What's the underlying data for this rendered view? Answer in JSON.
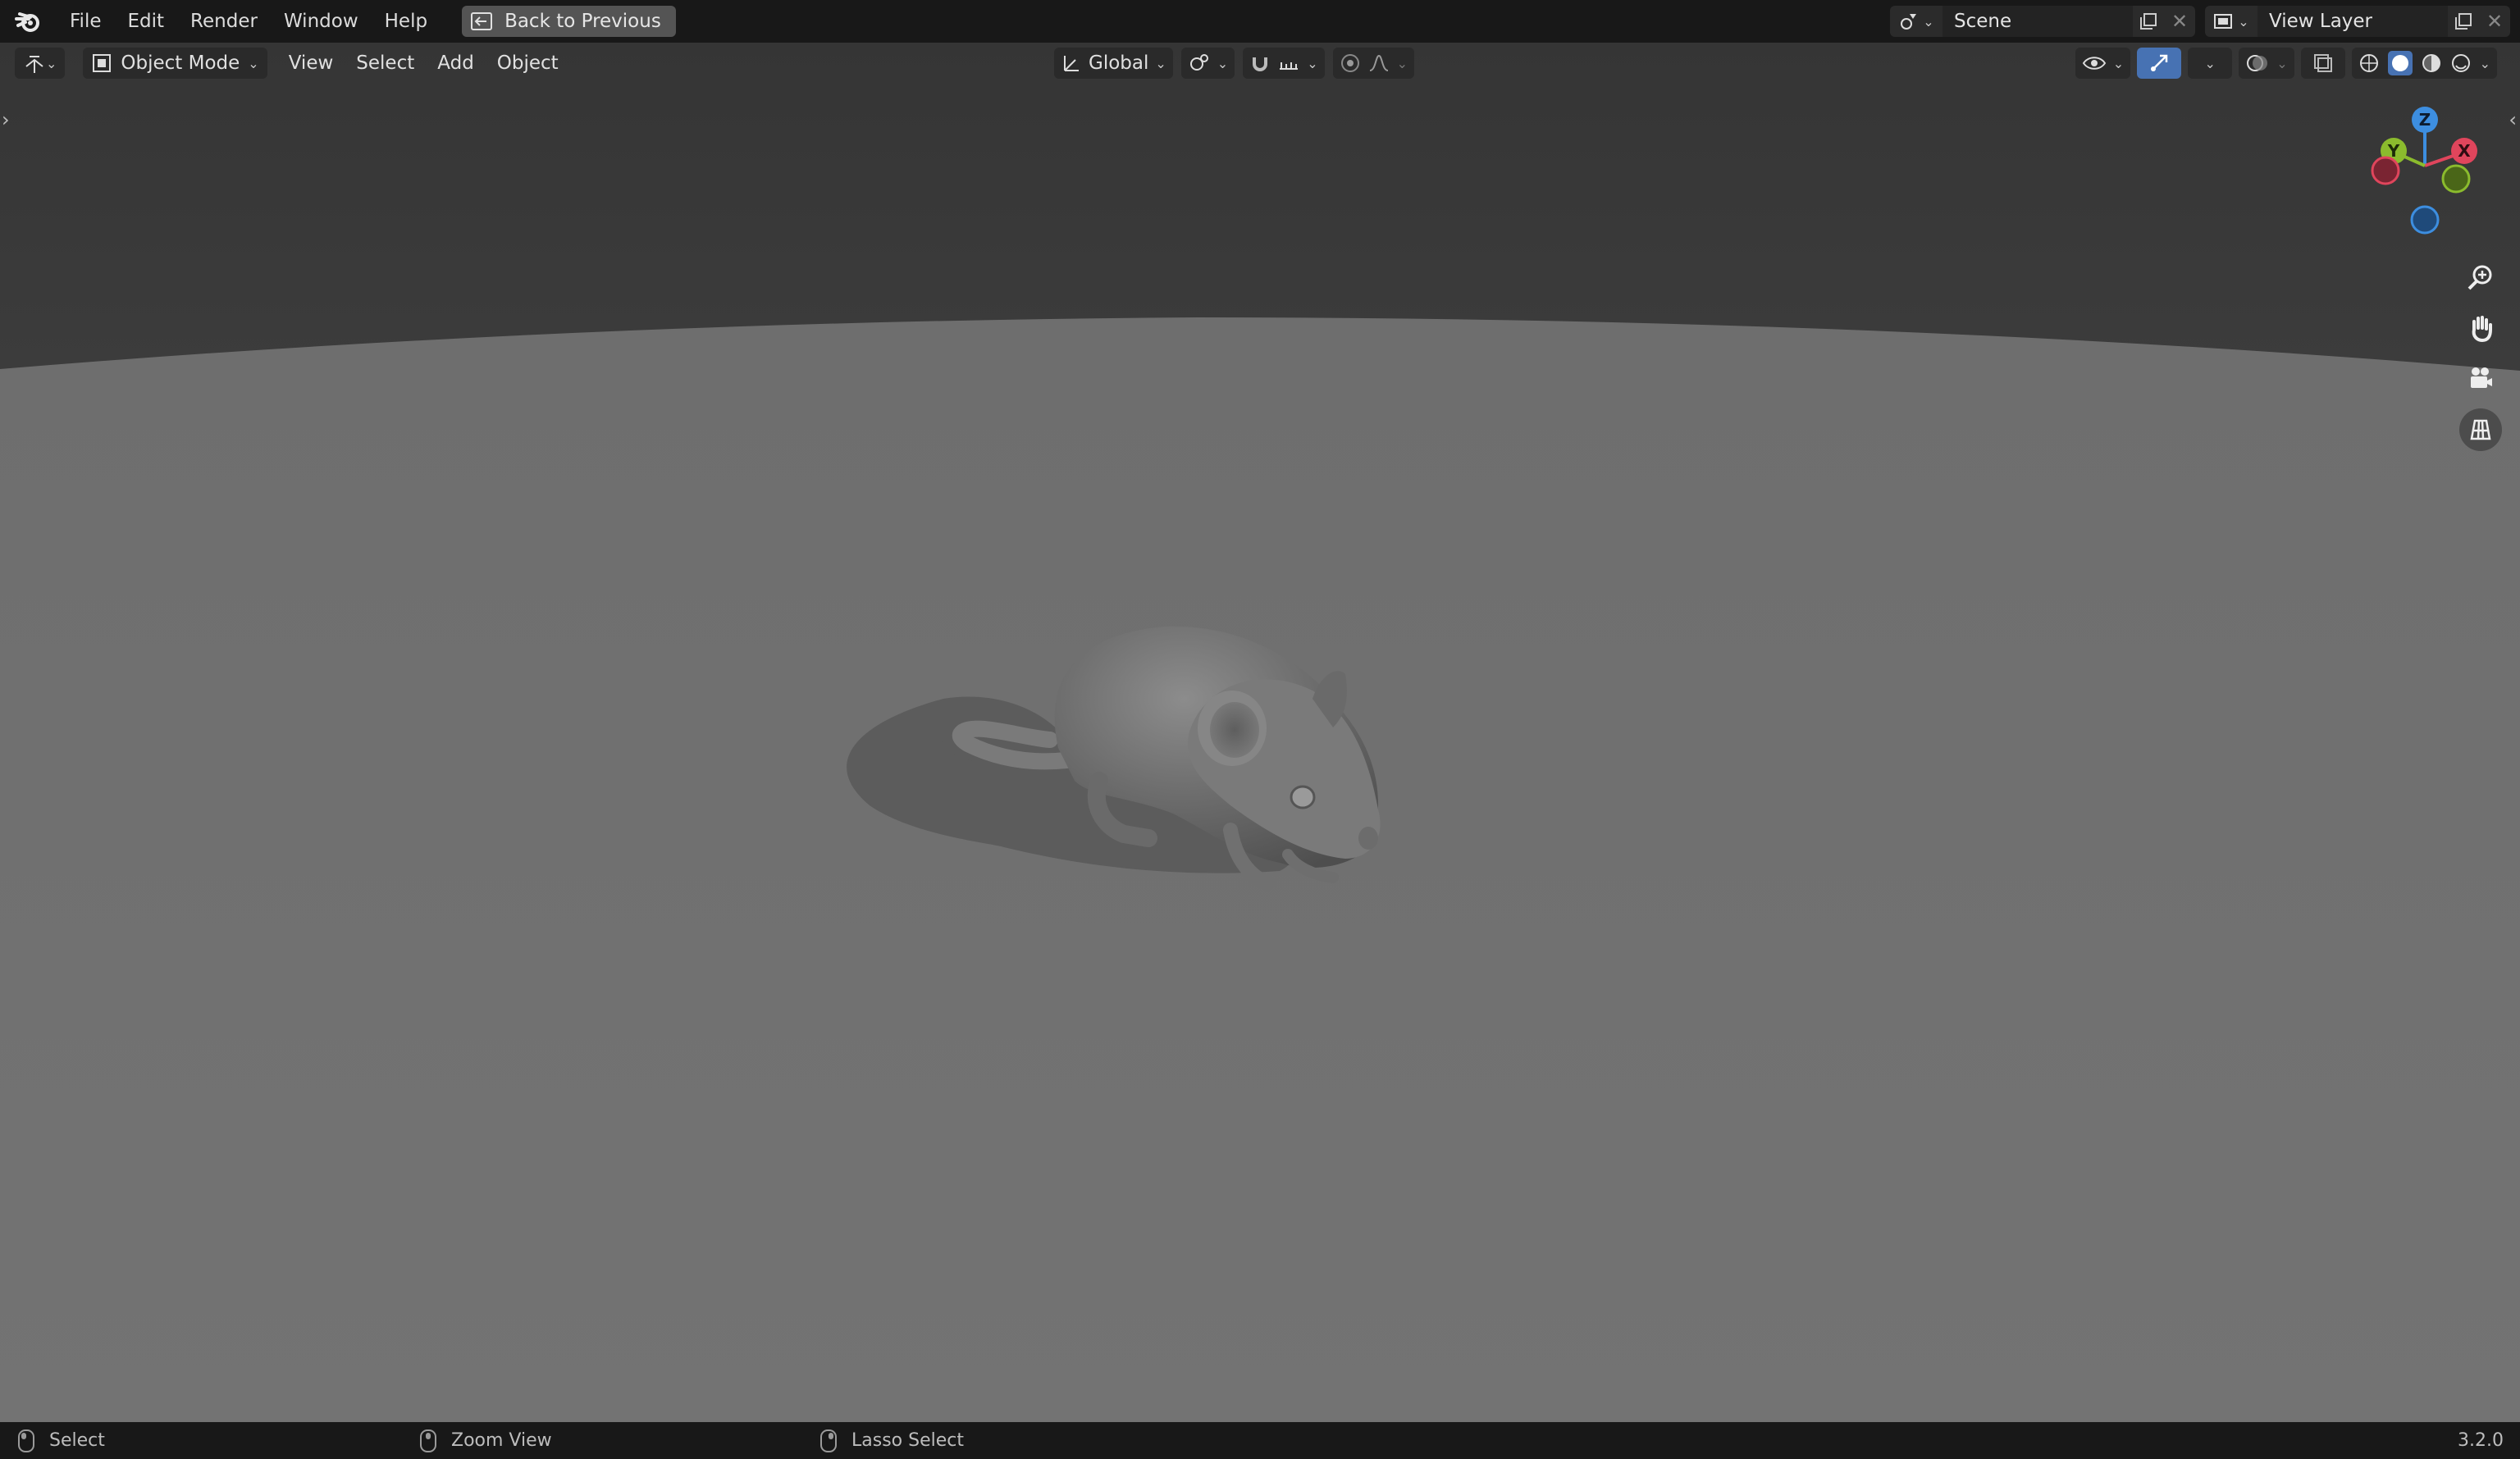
{
  "menu": {
    "items": [
      "File",
      "Edit",
      "Render",
      "Window",
      "Help"
    ],
    "back_button": "Back to Previous"
  },
  "scene": {
    "label": "Scene"
  },
  "view_layer": {
    "label": "View Layer"
  },
  "viewport_header": {
    "mode": "Object Mode",
    "menus": [
      "View",
      "Select",
      "Add",
      "Object"
    ],
    "transform_orientation": "Global"
  },
  "gizmo": {
    "x": "X",
    "y": "Y",
    "z": "Z"
  },
  "status": {
    "select": "Select",
    "zoom": "Zoom View",
    "lasso": "Lasso Select",
    "version": "3.2.0"
  },
  "colors": {
    "accent": "#4772b3",
    "axis_x": "#e0455c",
    "axis_y": "#8bbb2d",
    "axis_z": "#3d8ee0"
  }
}
